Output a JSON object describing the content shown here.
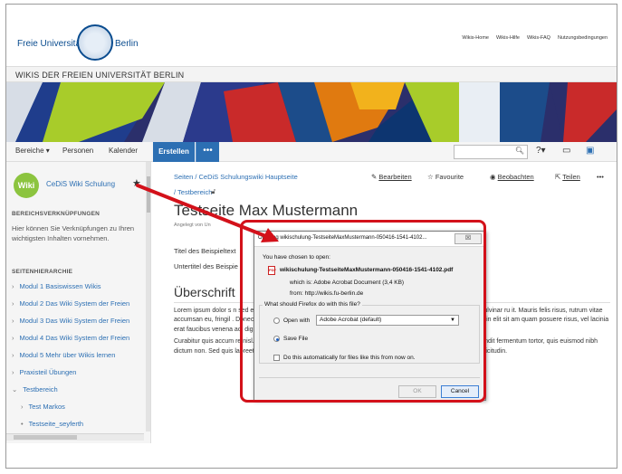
{
  "header": {
    "logo_left": "Freie Universität",
    "logo_right": "Berlin",
    "links": [
      "Wikis-Home",
      "Wikis-Hilfe",
      "Wikis-FAQ",
      "Nutzungsbedingungen"
    ]
  },
  "site_title": "WIKIS DER FREIEN UNIVERSITÄT BERLIN",
  "nav": {
    "items": [
      "Bereiche ▾",
      "Personen",
      "Kalender"
    ],
    "create_label": "Erstellen",
    "more_label": "•••",
    "search_icon": "search-icon",
    "help_label": "?▾",
    "notifications_icon": "tray-icon",
    "user_icon": "user-avatar-icon"
  },
  "sidebar": {
    "space_logo": "Wiki",
    "space_name": "CeDiS Wiki Schulung",
    "shortcuts_heading": "BEREICHSVERKNÜPFUNGEN",
    "shortcuts_text": "Hier können Sie Verknüpfungen zu Ihren wichtigsten Inhalten vornehmen.",
    "tree_heading": "SEITENHIERARCHIE",
    "items": [
      {
        "chev": "›",
        "label": "Modul 1 Basiswissen Wikis"
      },
      {
        "chev": "›",
        "label": "Modul 2 Das Wiki System der Freien"
      },
      {
        "chev": "›",
        "label": "Modul 3 Das Wiki System der Freien"
      },
      {
        "chev": "›",
        "label": "Modul 4 Das Wiki System der Freien"
      },
      {
        "chev": "›",
        "label": "Modul 5 Mehr über Wikis lernen"
      },
      {
        "chev": "›",
        "label": "Praxisteil Übungen"
      },
      {
        "chev": "⌄",
        "label": "Testbereich"
      },
      {
        "chev": "›",
        "label": "Test Markos"
      },
      {
        "chev": "•",
        "label": "Testseite_seyferth"
      }
    ]
  },
  "page": {
    "breadcrumb": "Seiten / CeDiS Schulungswiki Hauptseite",
    "breadcrumb2": "/ Testbereich",
    "actions": {
      "edit": "Bearbeiten",
      "favourite": "Favourite",
      "watch": "Beobachten",
      "share": "Teilen",
      "more": "•••"
    },
    "title": "Testseite Max Mustermann",
    "meta": "Angelegt von Un",
    "field1": "Titel des Beispieltext",
    "field2": "Untertitel des Beispie",
    "section_heading": "Überschrift",
    "paragraphs": [
      "Lorem ipsum dolor s                                                                                  n sed egestas felis. Proin congue, libero vel fri                                                                     dolor. Aenean ante arcu, mollis in erat id, pulvinar ru                                                              it. Mauris felis risus, rutrum vitae accumsan eu, fringil                                                            . Donec dapibus nulla eu lacus blandit consectetur                                                                ed euismod. Curabitur pretium sollicitudin elit sit am                                                              quam posuere risus, vel lacinia erat faucibus venena                                                                ac, dignissim iaculis ipsum.",
      "Curabitur quis accum                                                                                   re nisl. Nam ac eros gravida, mattis lectus vel, ultri                                                                Nam vehicula dapibus ante. Morbi blandit fermentum tortor, quis euismod nibh dictum non. Sed quis laoreet dui. Quisque accumsan dapibus molestie. Curabitur tempor volutpat magna in sollicitudin."
    ]
  },
  "dialog": {
    "title": "Opening wikischulung-TestseiteMaxMustermann-050416-1541-4102...",
    "close": "☒",
    "chosen_label": "You have chosen to open:",
    "file_icon": "pdf-file-icon",
    "filename": "wikischulung-TestseiteMaxMustermann-050416-1541-4102.pdf",
    "which_is": "which is:  Adobe Acrobat Document (3,4 KB)",
    "from": "from:  http://wikis.fu-berlin.de",
    "question": "What should Firefox do with this file?",
    "open_with_label": "Open with",
    "open_with_value": "Adobe Acrobat  (default)",
    "save_label": "Save File",
    "auto_label": "Do this automatically for files like this from now on.",
    "ok_label": "OK",
    "cancel_label": "Cancel",
    "selected_option": "Save File"
  },
  "colors": {
    "annotation": "#d3111a",
    "accent": "#2c6fb3",
    "wiki_green": "#8cc43f"
  }
}
